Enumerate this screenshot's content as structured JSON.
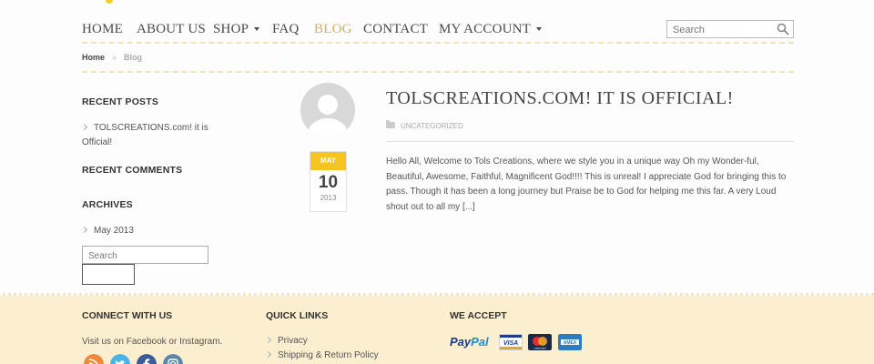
{
  "nav": {
    "items": [
      {
        "label": "HOME"
      },
      {
        "label": "ABOUT US"
      },
      {
        "label": "SHOP"
      },
      {
        "label": "FAQ"
      },
      {
        "label": "BLOG"
      },
      {
        "label": "CONTACT"
      },
      {
        "label": "MY ACCOUNT"
      }
    ],
    "active": "BLOG",
    "search_placeholder": "Search"
  },
  "breadcrumb": {
    "home": "Home",
    "separator": "»",
    "current": "Blog"
  },
  "sidebar": {
    "recent_posts_heading": "RECENT POSTS",
    "recent_posts": [
      "TOLSCREATIONS.com! it is Official!"
    ],
    "recent_comments_heading": "RECENT COMMENTS",
    "archives_heading": "ARCHIVES",
    "archives": [
      "May 2013"
    ],
    "search_placeholder": "Search"
  },
  "post": {
    "title": "TOLSCREATIONS.COM! IT IS OFFICIAL!",
    "category": "UNCATEGORIZED",
    "date": {
      "month": "MAY",
      "day": "10",
      "year": "2013"
    },
    "excerpt": "Hello All, Welcome to Tols Creations, where we style you in a unique way Oh my Wonder-ful, Beautiful, Awesome, Faithful, Magnificent God!!!! This is unreal! I appreciate God for bringing this to pass.  Though it has been a long journey but Praise be to God for helping me this far. A very Loud shout out to all my",
    "read_more": "[...]"
  },
  "footer": {
    "connect_heading": "CONNECT WITH US",
    "connect_text": "Visit us on Facebook or Instagram.",
    "social_icons": [
      "rss-icon",
      "twitter-icon",
      "facebook-icon",
      "instagram-icon"
    ],
    "quick_links_heading": "QUICK LINKS",
    "quick_links": [
      "Privacy",
      "Shipping & Return Policy"
    ],
    "accept_heading": "WE ACCEPT",
    "paypal_pay": "Pay",
    "paypal_pal": "Pal",
    "cards": [
      "VISA",
      "mastercard",
      "AMEX"
    ]
  },
  "colors": {
    "accent": "#d8ae5e",
    "date_badge": "#f5c420",
    "footer_bg": "#fcefd0",
    "rss": "#f0883a",
    "twitter": "#4ab3e8",
    "facebook": "#3b5a9a",
    "instagram": "#5b87a8"
  }
}
